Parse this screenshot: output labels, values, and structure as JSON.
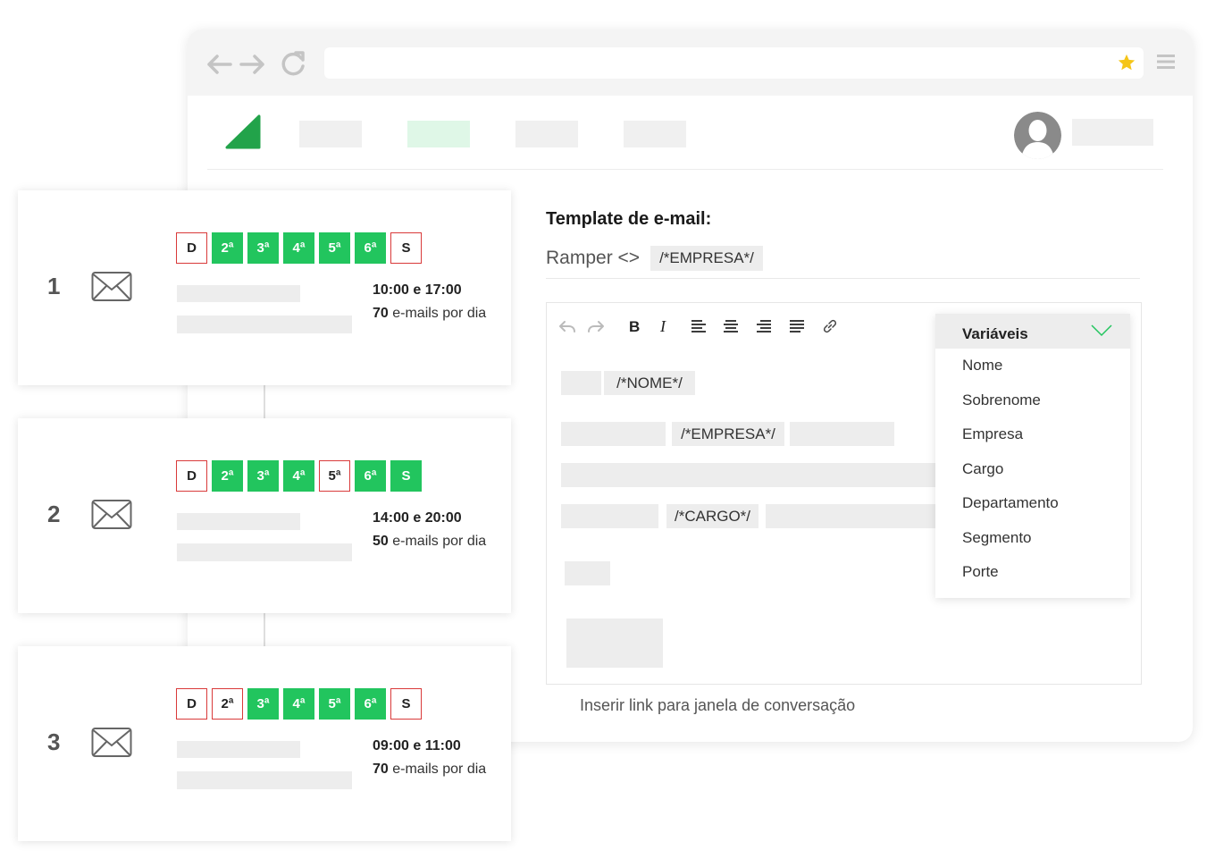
{
  "editor": {
    "title": "Template de e-mail:",
    "subject_text": "Ramper <>",
    "subject_tag": "/*EMPRESA*/",
    "body_tags": [
      "/*NOME*/",
      "/*EMPRESA*/",
      "/*CARGO*/"
    ],
    "insert_link": "Inserir link para janela de conversação"
  },
  "variables_dropdown": {
    "header": "Variáveis",
    "items": [
      "Nome",
      "Sobrenome",
      "Empresa",
      "Cargo",
      "Departamento",
      "Segmento",
      "Porte"
    ]
  },
  "steps": [
    {
      "number": "1",
      "days": [
        {
          "label": "D",
          "active": false
        },
        {
          "label": "2ª",
          "active": true
        },
        {
          "label": "3ª",
          "active": true
        },
        {
          "label": "4ª",
          "active": true
        },
        {
          "label": "5ª",
          "active": true
        },
        {
          "label": "6ª",
          "active": true
        },
        {
          "label": "S",
          "active": false
        }
      ],
      "time": "10:00 e 17:00",
      "volume_count": "70",
      "volume_label": " e-mails por dia"
    },
    {
      "number": "2",
      "days": [
        {
          "label": "D",
          "active": false
        },
        {
          "label": "2ª",
          "active": true
        },
        {
          "label": "3ª",
          "active": true
        },
        {
          "label": "4ª",
          "active": true
        },
        {
          "label": "5ª",
          "active": false
        },
        {
          "label": "6ª",
          "active": true
        },
        {
          "label": "S",
          "active": true
        }
      ],
      "time": "14:00 e 20:00",
      "volume_count": "50",
      "volume_label": " e-mails por dia"
    },
    {
      "number": "3",
      "days": [
        {
          "label": "D",
          "active": false
        },
        {
          "label": "2ª",
          "active": false
        },
        {
          "label": "3ª",
          "active": true
        },
        {
          "label": "4ª",
          "active": true
        },
        {
          "label": "5ª",
          "active": true
        },
        {
          "label": "6ª",
          "active": true
        },
        {
          "label": "S",
          "active": false
        }
      ],
      "time": "09:00 e 11:00",
      "volume_count": "70",
      "volume_label": " e-mails por dia"
    }
  ],
  "icons": {
    "toolbar": [
      "undo-icon",
      "redo-icon",
      "bold-icon",
      "italic-icon",
      "align-left-icon",
      "align-center-icon",
      "align-right-icon",
      "justify-icon",
      "link-icon"
    ]
  },
  "colors": {
    "accent_green": "#22c55e",
    "inactive_border": "#d93a3a",
    "star": "#f5c518"
  }
}
